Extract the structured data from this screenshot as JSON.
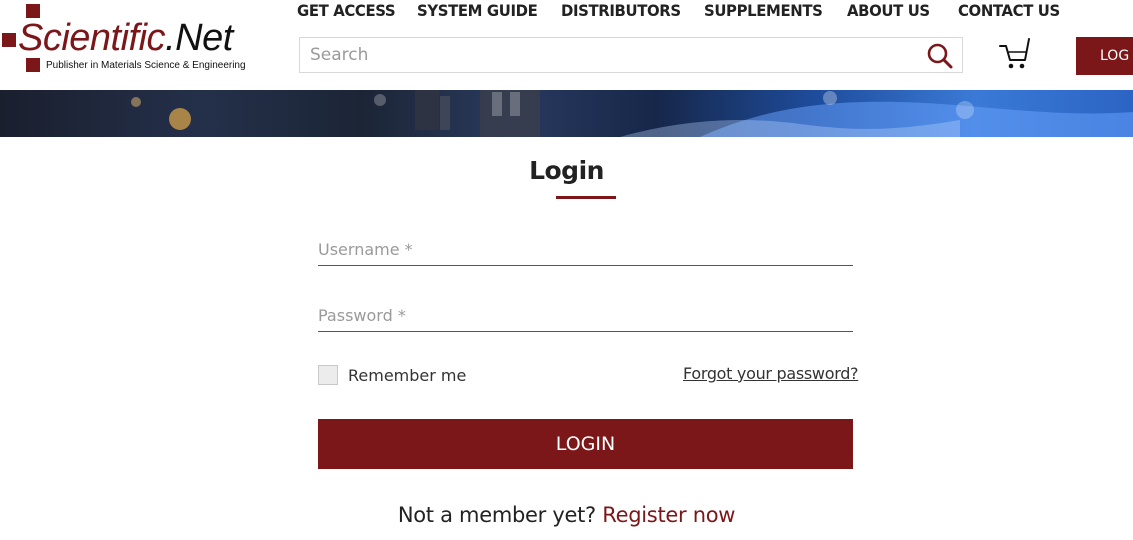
{
  "colors": {
    "brand": "#7b1619",
    "text": "#222222"
  },
  "logo": {
    "name_part1": "Scientific",
    "name_part2": ".Net",
    "tagline": "Publisher in Materials Science & Engineering"
  },
  "nav": {
    "items": [
      "GET ACCESS",
      "SYSTEM GUIDE",
      "DISTRIBUTORS",
      "SUPPLEMENTS",
      "ABOUT US",
      "CONTACT US"
    ]
  },
  "search": {
    "placeholder": "Search",
    "value": "",
    "icon": "search-icon"
  },
  "cart": {
    "icon": "cart-icon"
  },
  "header_login": {
    "label": "LOG"
  },
  "login_form": {
    "title": "Login",
    "username_placeholder": "Username *",
    "password_placeholder": "Password *",
    "remember_label": "Remember me",
    "forgot_label": "Forgot your password?",
    "submit_label": "LOGIN",
    "register_prompt": "Not a member yet?",
    "register_link": "Register now"
  }
}
